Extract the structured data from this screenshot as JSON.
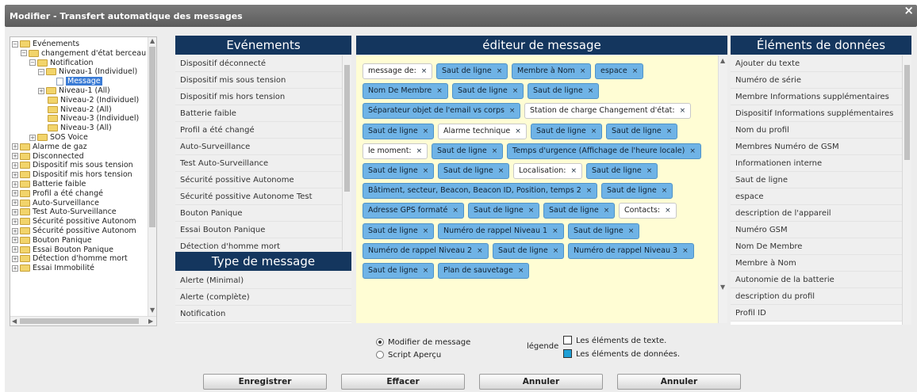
{
  "window": {
    "title": "Modifier - Transfert automatique des messages",
    "close": "×"
  },
  "tree": [
    {
      "label": "Evénements",
      "depth": 0,
      "icon": "folder",
      "expander": "−"
    },
    {
      "label": "changement d'état berceau",
      "depth": 1,
      "icon": "folder",
      "expander": "−"
    },
    {
      "label": "Notification",
      "depth": 2,
      "icon": "folder",
      "expander": "−"
    },
    {
      "label": "Niveau-1 (Individuel)",
      "depth": 3,
      "icon": "folder",
      "expander": "−"
    },
    {
      "label": "Message",
      "depth": 4,
      "icon": "doc",
      "selected": true
    },
    {
      "label": "Niveau-1 (All)",
      "depth": 3,
      "icon": "folder",
      "expander": "+"
    },
    {
      "label": "Niveau-2 (Individuel)",
      "depth": 3,
      "icon": "folder"
    },
    {
      "label": "Niveau-2 (All)",
      "depth": 3,
      "icon": "folder"
    },
    {
      "label": "Niveau-3 (Individuel)",
      "depth": 3,
      "icon": "folder"
    },
    {
      "label": "Niveau-3 (All)",
      "depth": 3,
      "icon": "folder"
    },
    {
      "label": "SOS Voice",
      "depth": 2,
      "icon": "folder",
      "expander": "+"
    },
    {
      "label": "Alarme de gaz",
      "depth": 0,
      "icon": "folder",
      "expander": "+"
    },
    {
      "label": "Disconnected",
      "depth": 0,
      "icon": "folder",
      "expander": "+"
    },
    {
      "label": "Dispositif mis sous tension",
      "depth": 0,
      "icon": "folder",
      "expander": "+"
    },
    {
      "label": "Dispositif mis hors tension",
      "depth": 0,
      "icon": "folder",
      "expander": "+"
    },
    {
      "label": "Batterie faible",
      "depth": 0,
      "icon": "folder",
      "expander": "+"
    },
    {
      "label": "Profil a été changé",
      "depth": 0,
      "icon": "folder",
      "expander": "+"
    },
    {
      "label": "Auto-Surveillance",
      "depth": 0,
      "icon": "folder",
      "expander": "+"
    },
    {
      "label": "Test Auto-Surveillance",
      "depth": 0,
      "icon": "folder",
      "expander": "+"
    },
    {
      "label": "Sécurité possitive Autonom",
      "depth": 0,
      "icon": "folder",
      "expander": "+"
    },
    {
      "label": "Sécurité possitive Autonom",
      "depth": 0,
      "icon": "folder",
      "expander": "+"
    },
    {
      "label": "Bouton Panique",
      "depth": 0,
      "icon": "folder",
      "expander": "+"
    },
    {
      "label": "Essai Bouton Panique",
      "depth": 0,
      "icon": "folder",
      "expander": "+"
    },
    {
      "label": "Détection d'homme mort",
      "depth": 0,
      "icon": "folder",
      "expander": "+"
    },
    {
      "label": "Essai Immobilité",
      "depth": 0,
      "icon": "folder",
      "expander": "+"
    }
  ],
  "events": {
    "header": "Evénements",
    "items": [
      "Dispositif déconnecté",
      "Dispositif mis sous tension",
      "Dispositif mis hors tension",
      "Batterie faible",
      "Profil a été changé",
      "Auto-Surveillance",
      "Test Auto-Surveillance",
      "Sécurité possitive Autonome",
      "Sécurité possitive Autonome Test",
      "Bouton Panique",
      "Essai Bouton Panique",
      "Détection d'homme mort"
    ]
  },
  "message_type": {
    "header": "Type de message",
    "items": [
      "Alerte (Minimal)",
      "Alerte (complète)",
      "Notification"
    ]
  },
  "editor": {
    "header": "éditeur de message",
    "rows": [
      [
        {
          "t": "message de:",
          "k": "text"
        },
        {
          "t": "Saut de ligne",
          "k": "data"
        },
        {
          "t": "Membre à Nom",
          "k": "data"
        },
        {
          "t": "espace",
          "k": "data"
        }
      ],
      [
        {
          "t": "Nom De Membre",
          "k": "data"
        },
        {
          "t": "Saut de ligne",
          "k": "data"
        },
        {
          "t": "Saut de ligne",
          "k": "data"
        }
      ],
      [
        {
          "t": "Séparateur objet de l'email vs corps",
          "k": "data"
        },
        {
          "t": "Station de charge Changement d'état:",
          "k": "text"
        }
      ],
      [
        {
          "t": "Saut de ligne",
          "k": "data"
        },
        {
          "t": "Alarme technique",
          "k": "text"
        },
        {
          "t": "Saut de ligne",
          "k": "data"
        },
        {
          "t": "Saut de ligne",
          "k": "data"
        }
      ],
      [
        {
          "t": "le moment:",
          "k": "text"
        },
        {
          "t": "Saut de ligne",
          "k": "data"
        },
        {
          "t": "Temps d'urgence (Affichage de l'heure locale)",
          "k": "data"
        }
      ],
      [
        {
          "t": "Saut de ligne",
          "k": "data"
        },
        {
          "t": "Saut de ligne",
          "k": "data"
        },
        {
          "t": "Localisation:",
          "k": "text"
        },
        {
          "t": "Saut de ligne",
          "k": "data"
        }
      ],
      [
        {
          "t": "Bâtiment, secteur, Beacon, Beacon ID, Position, temps 2",
          "k": "data"
        },
        {
          "t": "Saut de ligne",
          "k": "data"
        }
      ],
      [
        {
          "t": "Adresse GPS formaté",
          "k": "data"
        },
        {
          "t": "Saut de ligne",
          "k": "data"
        },
        {
          "t": "Saut de ligne",
          "k": "data"
        },
        {
          "t": "Contacts:",
          "k": "text"
        }
      ],
      [
        {
          "t": "Saut de ligne",
          "k": "data"
        },
        {
          "t": "Numéro de rappel Niveau 1",
          "k": "data"
        },
        {
          "t": "Saut de ligne",
          "k": "data"
        }
      ],
      [
        {
          "t": "Numéro de rappel Niveau 2",
          "k": "data"
        },
        {
          "t": "Saut de ligne",
          "k": "data"
        },
        {
          "t": "Numéro de rappel Niveau 3",
          "k": "data"
        }
      ],
      [
        {
          "t": "Saut de ligne",
          "k": "data"
        },
        {
          "t": "Plan de sauvetage",
          "k": "data"
        }
      ]
    ]
  },
  "data_elements": {
    "header": "Éléments de données",
    "items": [
      "Ajouter du texte",
      "Numéro de série",
      "Membre Informations supplémentaires",
      "Dispositif Informations supplémentaires",
      "Nom du profil",
      "Membres Numéro de GSM",
      "Informationen interne",
      "Saut de ligne",
      "espace",
      "description de l'appareil",
      "Numéro GSM",
      "Nom De Membre",
      "Membre à Nom",
      "Autonomie de la batterie",
      "description du profil",
      "Profil ID"
    ]
  },
  "mode": {
    "options": [
      {
        "label": "Modifier de message",
        "selected": true
      },
      {
        "label": "Script Aperçu",
        "selected": false
      }
    ]
  },
  "legend": {
    "label": "légende",
    "text_elements": "Les éléments de texte.",
    "data_elements": "Les éléments de données.",
    "text_color": "#ffffff",
    "data_color": "#1e9fd6"
  },
  "buttons": {
    "save": "Enregistrer",
    "clear": "Effacer",
    "cancel1": "Annuler",
    "cancel2": "Annuler"
  }
}
